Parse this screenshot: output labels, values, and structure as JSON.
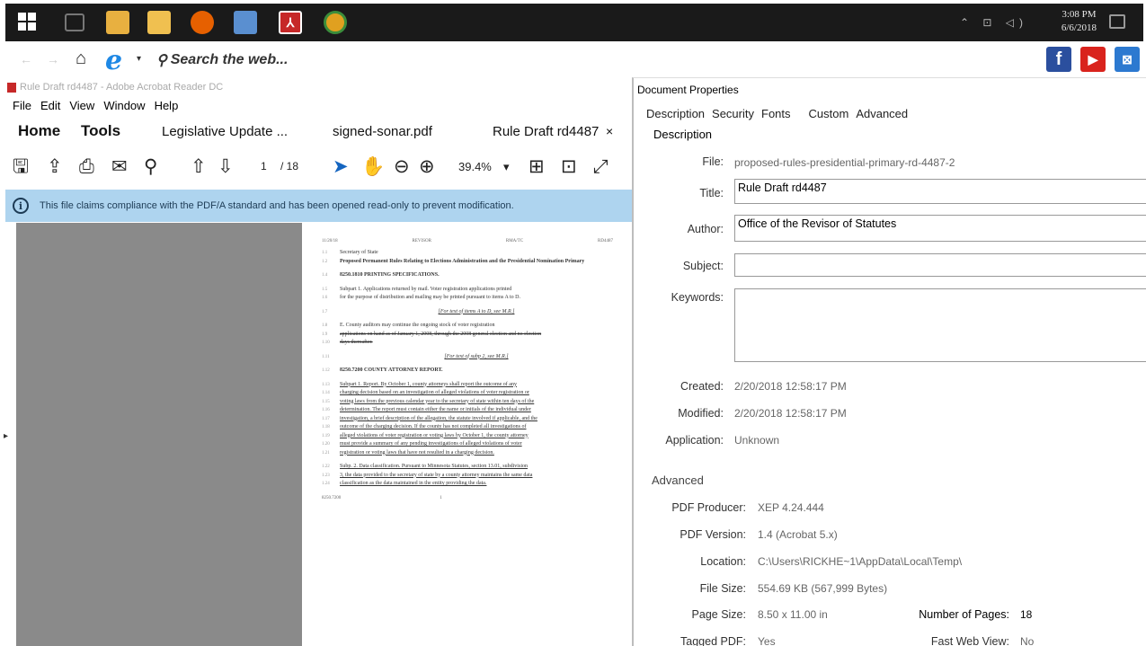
{
  "taskbar": {
    "time": "3:08 PM",
    "date": "6/6/2018",
    "tray": "⌃ ⊡ ◁)",
    "apps": [
      {
        "name": "task-view",
        "color": "#777777"
      },
      {
        "name": "file-explorer",
        "color": "#e8b040"
      },
      {
        "name": "folder",
        "color": "#f0c050"
      },
      {
        "name": "firefox",
        "color": "#e66000"
      },
      {
        "name": "notepad",
        "color": "#5a8fd0"
      },
      {
        "name": "acrobat",
        "color": "#c62828"
      },
      {
        "name": "chrome",
        "color": "#e0a020"
      }
    ]
  },
  "browser": {
    "search_label": "Search the web...",
    "social": {
      "facebook": "f",
      "youtube": "▶",
      "other": "⊠"
    }
  },
  "acrobat": {
    "window_title": "Rule Draft rd4487 - Adobe Acrobat Reader DC",
    "menu": [
      "File",
      "Edit",
      "View",
      "Window",
      "Help"
    ],
    "tabs": {
      "home": "Home",
      "tools": "Tools",
      "doc1": "Legislative Update ...",
      "doc2": "signed-sonar.pdf",
      "doc3": "Rule Draft rd4487",
      "close": "×"
    },
    "toolbar": {
      "page_current": "1",
      "page_total": "/ 18",
      "zoom": "39.4%",
      "zoom_caret": "▾"
    },
    "infobar": {
      "icon": "i",
      "message": "This file claims compliance with the PDF/A standard and has been opened read-only to prevent modification."
    }
  },
  "pdf": {
    "header": [
      "11/20/18",
      "REVISOR",
      "RMA/TC",
      "RD4487"
    ],
    "lines": [
      {
        "n": "1.1",
        "t": "Secretary of State",
        "c": ""
      },
      {
        "n": "1.2",
        "t": "Proposed Permanent Rules Relating to Elections Administration and the Presidential Nomination Primary",
        "c": "pg-bold"
      },
      {
        "n": "",
        "t": "",
        "c": "gap"
      },
      {
        "n": "1.4",
        "t": "8250.1810  PRINTING SPECIFICATIONS.",
        "c": "pg-bold"
      },
      {
        "n": "",
        "t": "",
        "c": "gap"
      },
      {
        "n": "1.5",
        "t": "Subpart 1.  Applications returned by mail. Voter registration applications printed",
        "c": ""
      },
      {
        "n": "1.6",
        "t": "for the purpose of distribution and mailing may be printed pursuant to items A to D.",
        "c": ""
      },
      {
        "n": "",
        "t": "",
        "c": "gap"
      },
      {
        "n": "1.7",
        "t": "[For text of items A to D, see M.R.]",
        "c": "pg-center"
      },
      {
        "n": "",
        "t": "",
        "c": "gap"
      },
      {
        "n": "1.8",
        "t": "E.  County auditors may continue the ongoing stock of voter registration",
        "c": ""
      },
      {
        "n": "1.9",
        "t": "applications on hand as of January 1, 2008, through the 2008 general election and no election",
        "c": "pg-strike"
      },
      {
        "n": "1.10",
        "t": "days thereafter.",
        "c": "pg-strike"
      },
      {
        "n": "",
        "t": "",
        "c": "gap"
      },
      {
        "n": "1.11",
        "t": "[For text of subp 2, see M.R.]",
        "c": "pg-center"
      },
      {
        "n": "",
        "t": "",
        "c": "gap"
      },
      {
        "n": "1.12",
        "t": "8250.7200  COUNTY ATTORNEY REPORT.",
        "c": "pg-bold"
      },
      {
        "n": "",
        "t": "",
        "c": "gap"
      },
      {
        "n": "1.13",
        "t": "Subpart 1.  Report.  By October 1, county attorneys shall report the outcome of any",
        "c": "pg-ul"
      },
      {
        "n": "1.14",
        "t": "charging decision based on an investigation of alleged violations of voter registration or",
        "c": "pg-ul"
      },
      {
        "n": "1.15",
        "t": "voting laws from the previous calendar year to the secretary of state within ten days of the",
        "c": "pg-ul"
      },
      {
        "n": "1.16",
        "t": "determination. The report must contain either the name or initials of the individual under",
        "c": "pg-ul"
      },
      {
        "n": "1.17",
        "t": "investigation, a brief description of the allegation, the statute involved if applicable, and the",
        "c": "pg-ul"
      },
      {
        "n": "1.18",
        "t": "outcome of the charging decision. If the county has not completed all investigations of",
        "c": "pg-ul"
      },
      {
        "n": "1.19",
        "t": "alleged violations of voter registration or voting laws by October 1, the county attorney",
        "c": "pg-ul"
      },
      {
        "n": "1.20",
        "t": "must provide a summary of any pending investigations of alleged violations of voter",
        "c": "pg-ul"
      },
      {
        "n": "1.21",
        "t": "registration or voting laws that have not resulted in a charging decision.",
        "c": "pg-ul"
      },
      {
        "n": "",
        "t": "",
        "c": "gap"
      },
      {
        "n": "1.22",
        "t": "Subp. 2.  Data classification. Pursuant to Minnesota Statutes, section 13.01, subdivision",
        "c": "pg-ul"
      },
      {
        "n": "1.23",
        "t": "3, the data provided to the secretary of state by a county attorney maintains the same data",
        "c": "pg-ul"
      },
      {
        "n": "1.24",
        "t": "classification as the data maintained in the entity providing the data.",
        "c": "pg-ul"
      }
    ],
    "footer": [
      "8250.7200",
      "1"
    ]
  },
  "dialog": {
    "title": "Document Properties",
    "tabs": [
      "Description",
      "Security",
      "Fonts",
      "Custom",
      "Advanced"
    ],
    "description_header": "Description",
    "file_label": "File:",
    "file_value": "proposed-rules-presidential-primary-rd-4487-2",
    "title_label": "Title:",
    "title_value": "Rule Draft rd4487",
    "author_label": "Author:",
    "author_value": "Office of the Revisor of Statutes",
    "subject_label": "Subject:",
    "subject_value": "",
    "keywords_label": "Keywords:",
    "keywords_value": "",
    "created_label": "Created:",
    "created_value": "2/20/2018 12:58:17 PM",
    "modified_label": "Modified:",
    "modified_value": "2/20/2018 12:58:17 PM",
    "application_label": "Application:",
    "application_value": "Unknown",
    "advanced_header": "Advanced",
    "producer_label": "PDF Producer:",
    "producer_value": "XEP 4.24.444",
    "version_label": "PDF Version:",
    "version_value": "1.4 (Acrobat 5.x)",
    "location_label": "Location:",
    "location_value": "C:\\Users\\RICKHE~1\\AppData\\Local\\Temp\\",
    "filesize_label": "File Size:",
    "filesize_value": "554.69 KB (567,999 Bytes)",
    "pagesize_label": "Page Size:",
    "pagesize_value": "8.50 x 11.00 in",
    "numpages_label": "Number of Pages:",
    "numpages_value": "18",
    "tagged_label": "Tagged PDF:",
    "tagged_value": "Yes",
    "fastweb_label": "Fast Web View:",
    "fastweb_value": "No"
  }
}
